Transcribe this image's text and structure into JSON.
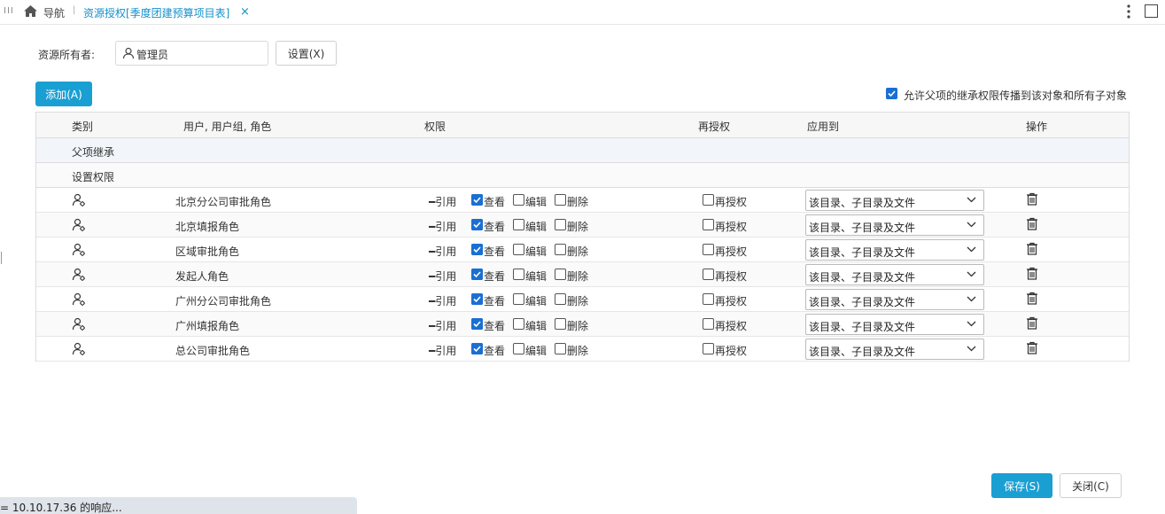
{
  "topbar": {
    "nav_label": "导航",
    "tab_label": "资源授权[季度团建预算项目表]",
    "tab_close": "×"
  },
  "owner": {
    "label": "资源所有者:",
    "value": "管理员",
    "set_button": "设置(X)"
  },
  "toolbar": {
    "add_button": "添加(A)",
    "inherit_checked": true,
    "inherit_label": "允许父项的继承权限传播到该对象和所有子对象"
  },
  "table": {
    "columns": [
      "类别",
      "用户, 用户组, 角色",
      "权限",
      "再授权",
      "应用到",
      "操作"
    ],
    "groups": [
      "父项继承",
      "设置权限"
    ],
    "perm_labels": {
      "ref": "━引用",
      "view": "查看",
      "edit": "编辑",
      "delete": "删除",
      "regrant": "再授权"
    },
    "rows": [
      {
        "name": "北京分公司审批角色",
        "view": true,
        "edit": false,
        "delete": false,
        "regrant": false,
        "apply_to": "该目录、子目录及文件"
      },
      {
        "name": "北京填报角色",
        "view": true,
        "edit": false,
        "delete": false,
        "regrant": false,
        "apply_to": "该目录、子目录及文件"
      },
      {
        "name": "区域审批角色",
        "view": true,
        "edit": false,
        "delete": false,
        "regrant": false,
        "apply_to": "该目录、子目录及文件"
      },
      {
        "name": "发起人角色",
        "view": true,
        "edit": false,
        "delete": false,
        "regrant": false,
        "apply_to": "该目录、子目录及文件"
      },
      {
        "name": "广州分公司审批角色",
        "view": true,
        "edit": false,
        "delete": false,
        "regrant": false,
        "apply_to": "该目录、子目录及文件"
      },
      {
        "name": "广州填报角色",
        "view": true,
        "edit": false,
        "delete": false,
        "regrant": false,
        "apply_to": "该目录、子目录及文件"
      },
      {
        "name": "总公司审批角色",
        "view": true,
        "edit": false,
        "delete": false,
        "regrant": false,
        "apply_to": "该目录、子目录及文件"
      }
    ]
  },
  "footer": {
    "save_button": "保存(S)",
    "close_button": "关闭(C)"
  },
  "statusbar": {
    "text": "= 10.10.17.36 的响应..."
  },
  "colors": {
    "accent": "#1a9fd3",
    "checkbox": "#1a6fd3",
    "tab_text": "#1590c9"
  }
}
